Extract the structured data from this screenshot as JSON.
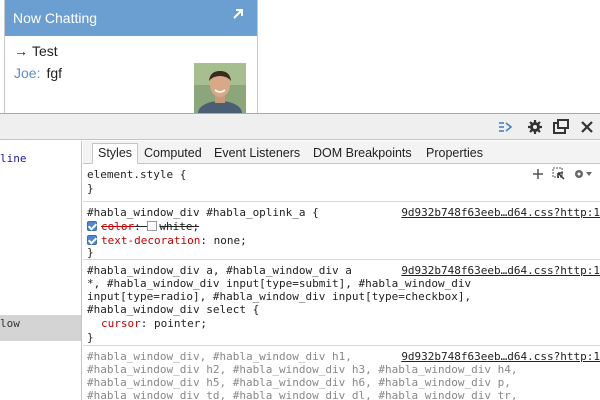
{
  "chat": {
    "title": "Now Chatting",
    "messages": [
      {
        "arrow": "→",
        "text": "Test"
      },
      {
        "sender": "Joe:",
        "text": "fgf"
      }
    ]
  },
  "devtools": {
    "left_panel": {
      "dom_line": "line",
      "dom_selected": "low"
    },
    "tabs": [
      "Styles",
      "Computed",
      "Event Listeners",
      "DOM Breakpoints",
      "Properties"
    ],
    "styles": {
      "element_style": {
        "selector": "element.style {",
        "close": "}"
      },
      "rule1": {
        "selector": "#habla_window_div #habla_oplink_a {",
        "source": "9d932b748f63eeb…d64.css?http:1",
        "decl1_name": "color",
        "decl1_value": "white;",
        "decl2_name": "text-decoration",
        "decl2_value": "none;",
        "close": "}"
      },
      "rule2": {
        "selector_line1": "#habla_window_div a, #habla_window_div a",
        "source": "9d932b748f63eeb…d64.css?http:1",
        "selector_line2": "*, #habla_window_div input[type=submit], #habla_window_div",
        "selector_line3": "input[type=radio], #habla_window_div input[type=checkbox],",
        "selector_line4": "#habla_window_div select {",
        "decl1_name": "cursor",
        "decl1_value": "pointer;",
        "close": "}"
      },
      "rule3": {
        "selector_line1": "#habla_window_div, #habla_window_div h1,",
        "source": "9d932b748f63eeb…d64.css?http:1",
        "selector_line2": "#habla_window_div h2, #habla_window_div h3, #habla_window_div h4,",
        "selector_line3": "#habla_window_div h5, #habla_window_div h6, #habla_window_div p,",
        "selector_line4": "#habla_window_div td, #habla_window_div dl, #habla_window_div tr,"
      }
    }
  },
  "colors": {
    "chat_header": "#6b9fd2",
    "sender": "#5b8dc4",
    "property_name": "#c80000"
  },
  "icons": [
    "popout-arrow-icon",
    "dock-side-icon",
    "gear-icon",
    "undock-icon",
    "close-icon",
    "add-rule-icon",
    "element-state-icon",
    "settings-icon"
  ]
}
